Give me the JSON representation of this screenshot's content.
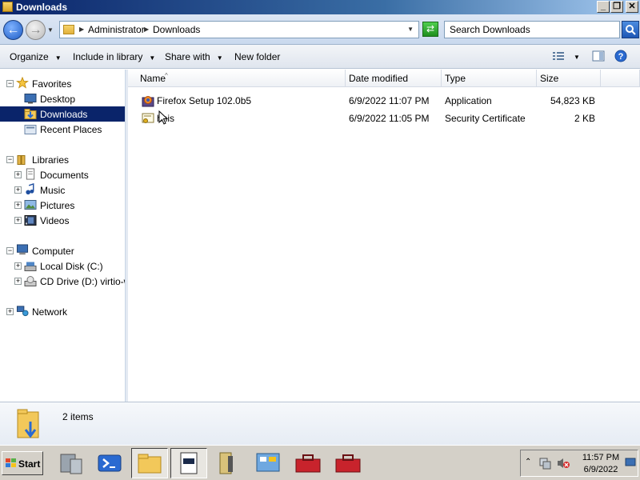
{
  "window": {
    "title": "Downloads",
    "controls": {
      "minimize": "_",
      "maximize": "❐",
      "close": "✕"
    }
  },
  "address": {
    "crumbs": [
      "Administrator",
      "Downloads"
    ],
    "search_placeholder": "Search Downloads"
  },
  "commandbar": {
    "organize": "Organize",
    "include_in_library": "Include in library",
    "share_with": "Share with",
    "new_folder": "New folder"
  },
  "navigation": {
    "favorites": {
      "label": "Favorites",
      "items": [
        "Desktop",
        "Downloads",
        "Recent Places"
      ]
    },
    "libraries": {
      "label": "Libraries",
      "items": [
        "Documents",
        "Music",
        "Pictures",
        "Videos"
      ]
    },
    "computer": {
      "label": "Computer",
      "items": [
        "Local Disk (C:)",
        "CD Drive (D:) virtio-win"
      ]
    },
    "network": {
      "label": "Network"
    },
    "selected": "Downloads"
  },
  "columns": [
    "Name",
    "Date modified",
    "Type",
    "Size"
  ],
  "files": [
    {
      "name": "Firefox Setup 102.0b5",
      "date": "6/9/2022 11:07 PM",
      "type": "Application",
      "size": "54,823 KB",
      "icon": "firefox-installer-icon"
    },
    {
      "name": "hnis",
      "date": "6/9/2022 11:05 PM",
      "type": "Security Certificate",
      "size": "2 KB",
      "icon": "certificate-icon"
    }
  ],
  "details": {
    "count": "2 items"
  },
  "taskbar": {
    "start": "Start",
    "time": "11:57 PM",
    "date": "6/9/2022"
  },
  "colors": {
    "selection": "#0a246a",
    "titlebar": "#0a246a"
  }
}
